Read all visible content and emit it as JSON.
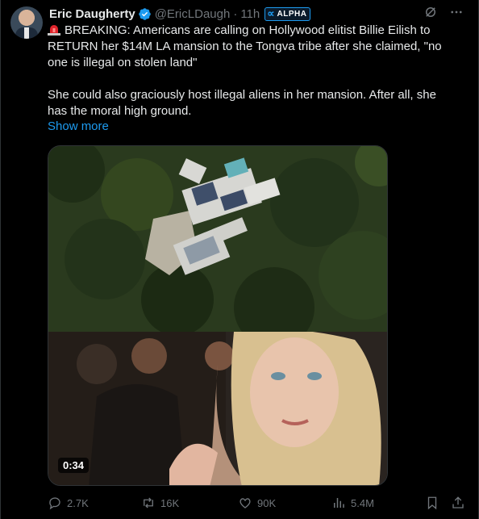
{
  "post": {
    "author_name": "Eric Daugherty",
    "handle": "@EricLDaugh",
    "separator": "·",
    "time": "11h",
    "badge_text": "ALPHA",
    "text_line_1": "BREAKING: Americans are calling on Hollywood elitist Billie Eilish to RETURN her $14M LA mansion to the Tongva tribe after she claimed, \"no one is illegal on stolen land\"",
    "text_line_2": "She could also graciously host illegal aliens in her mansion. After all, she has the moral high ground.",
    "show_more": "Show more",
    "video_duration": "0:34"
  },
  "metrics": {
    "replies": "2.7K",
    "reposts": "16K",
    "likes": "90K",
    "views": "5.4M"
  },
  "colors": {
    "accent": "#1d9bf0",
    "muted": "#71767b",
    "text": "#e7e9ea",
    "background": "#000000"
  },
  "icons": [
    "verified-badge-icon",
    "grok-icon",
    "more-icon",
    "siren-icon",
    "reply-icon",
    "repost-icon",
    "like-icon",
    "views-icon",
    "bookmark-icon",
    "share-icon"
  ]
}
